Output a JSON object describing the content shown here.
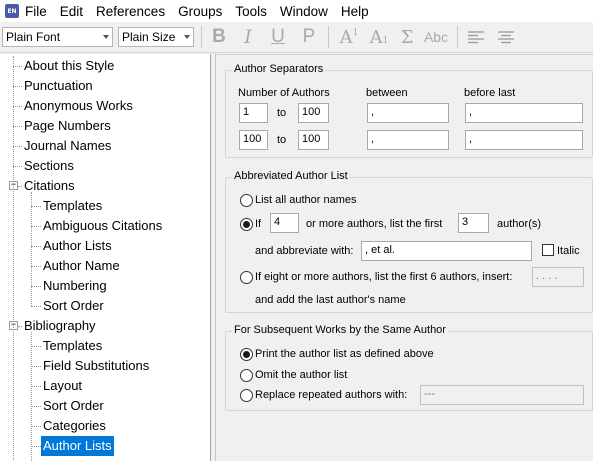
{
  "app": {
    "icon_text": "EN"
  },
  "menu": [
    "File",
    "Edit",
    "References",
    "Groups",
    "Tools",
    "Window",
    "Help"
  ],
  "toolbar": {
    "font": "Plain Font",
    "size": "Plain Size",
    "bold": "B",
    "italic": "I",
    "underline": "U",
    "plain": "P",
    "superscript": "A",
    "superscript_mark": "1",
    "subscript": "A",
    "subscript_mark": "1",
    "symbol": "Σ",
    "small_caps": "Abc"
  },
  "tree": [
    {
      "label": "About this Style",
      "level": 0
    },
    {
      "label": "Punctuation",
      "level": 0
    },
    {
      "label": "Anonymous Works",
      "level": 0
    },
    {
      "label": "Page Numbers",
      "level": 0
    },
    {
      "label": "Journal Names",
      "level": 0
    },
    {
      "label": "Sections",
      "level": 0
    },
    {
      "label": "Citations",
      "level": 0,
      "expander": "-"
    },
    {
      "label": "Templates",
      "level": 1
    },
    {
      "label": "Ambiguous Citations",
      "level": 1
    },
    {
      "label": "Author Lists",
      "level": 1
    },
    {
      "label": "Author Name",
      "level": 1
    },
    {
      "label": "Numbering",
      "level": 1
    },
    {
      "label": "Sort Order",
      "level": 1
    },
    {
      "label": "Bibliography",
      "level": 0,
      "expander": "-"
    },
    {
      "label": "Templates",
      "level": 1
    },
    {
      "label": "Field Substitutions",
      "level": 1
    },
    {
      "label": "Layout",
      "level": 1
    },
    {
      "label": "Sort Order",
      "level": 1
    },
    {
      "label": "Categories",
      "level": 1
    },
    {
      "label": "Author Lists",
      "level": 1,
      "selected": true
    }
  ],
  "separators": {
    "title": "Author Separators",
    "col_number": "Number of Authors",
    "col_between": "between",
    "col_before_last": "before last",
    "to_label": "to",
    "rows": [
      {
        "from": "1",
        "to": "100",
        "between": ",",
        "before_last": ","
      },
      {
        "from": "100",
        "to": "100",
        "between": ",",
        "before_last": ","
      }
    ]
  },
  "abbreviated": {
    "title": "Abbreviated Author List",
    "list_all": "List all author names",
    "if_label": "If",
    "if_count": "4",
    "or_more": "or more authors, list the first",
    "first_count": "3",
    "authors_s": "author(s)",
    "abbreviate_with": "and abbreviate with:",
    "abbrev_value": ", et al.",
    "italic": "Italic",
    "eight_more": "If eight or more authors, list the first 6 authors, insert:",
    "eight_value": ". . . .",
    "add_last": "and add the last author's name",
    "selected": "if"
  },
  "subsequent": {
    "title": "For Subsequent Works by the Same Author",
    "print_as_defined": "Print the author list as defined above",
    "omit": "Omit the author list",
    "replace": "Replace repeated authors with:",
    "replace_value": "---",
    "selected": "print"
  }
}
